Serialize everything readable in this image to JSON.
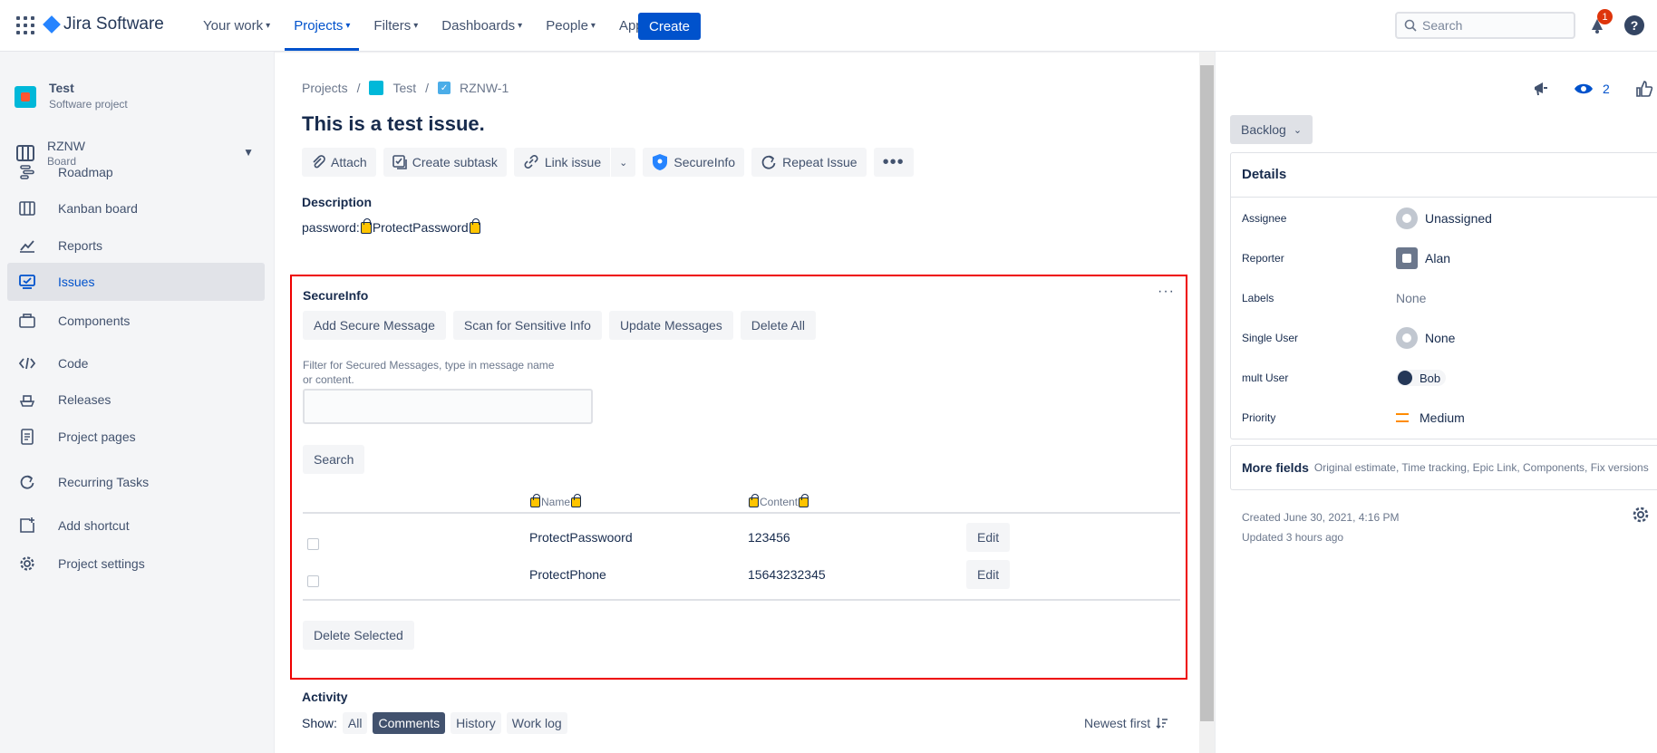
{
  "app": {
    "logo_text": "Jira Software"
  },
  "topnav": {
    "items": [
      {
        "label": "Your work"
      },
      {
        "label": "Projects"
      },
      {
        "label": "Filters"
      },
      {
        "label": "Dashboards"
      },
      {
        "label": "People"
      },
      {
        "label": "Apps"
      }
    ],
    "create_label": "Create",
    "search_placeholder": "Search",
    "notification_count": "1",
    "help_label": "?"
  },
  "sidebar": {
    "project_name": "Test",
    "project_type": "Software project",
    "board_name": "RZNW",
    "board_sub": "Board",
    "items": [
      {
        "label": "Roadmap",
        "icon": "roadmap-icon"
      },
      {
        "label": "Kanban board",
        "icon": "kanban-icon"
      },
      {
        "label": "Reports",
        "icon": "reports-icon"
      },
      {
        "label": "Issues",
        "icon": "issues-icon"
      },
      {
        "label": "Components",
        "icon": "components-icon"
      },
      {
        "label": "Code",
        "icon": "code-icon"
      },
      {
        "label": "Releases",
        "icon": "releases-icon"
      },
      {
        "label": "Project pages",
        "icon": "pages-icon"
      },
      {
        "label": "Recurring Tasks",
        "icon": "recurring-icon"
      },
      {
        "label": "Add shortcut",
        "icon": "add-shortcut-icon"
      },
      {
        "label": "Project settings",
        "icon": "settings-icon"
      }
    ],
    "active_item": "Issues"
  },
  "issue": {
    "breadcrumb": {
      "projects": "Projects",
      "project": "Test",
      "key": "RZNW-1",
      "sep": "/"
    },
    "title": "This is a test issue.",
    "toolbar": {
      "attach": "Attach",
      "create_subtask": "Create subtask",
      "link_issue": "Link issue",
      "secureinfo": "SecureInfo",
      "repeat_issue": "Repeat Issue"
    },
    "description_label": "Description",
    "description_prefix": "password:",
    "description_value": "ProtectPassword"
  },
  "secureinfo": {
    "title": "SecureInfo",
    "actions": {
      "add": "Add Secure Message",
      "scan": "Scan for Sensitive Info",
      "update": "Update Messages",
      "delete_all": "Delete All"
    },
    "filter_label": "Filter for Secured Messages, type in message name or content.",
    "filter_value": "",
    "search_label": "Search",
    "columns": {
      "name": "Name",
      "content": "Content"
    },
    "rows": [
      {
        "name": "ProtectPasswoord",
        "content": "123456",
        "edit": "Edit"
      },
      {
        "name": "ProtectPhone",
        "content": "15643232345",
        "edit": "Edit"
      }
    ],
    "delete_selected": "Delete Selected"
  },
  "activity": {
    "label": "Activity",
    "show_label": "Show:",
    "filters": [
      "All",
      "Comments",
      "History",
      "Work log"
    ],
    "selected_filter": "Comments",
    "sort_label": "Newest first"
  },
  "right_panel": {
    "watchers": "2",
    "status": "Backlog",
    "details_title": "Details",
    "fields": [
      {
        "label": "Assignee",
        "value": "Unassigned"
      },
      {
        "label": "Reporter",
        "value": "Alan"
      },
      {
        "label": "Labels",
        "value": "None"
      },
      {
        "label": "Single User",
        "value": "None"
      },
      {
        "label": "mult User",
        "value": "Bob"
      },
      {
        "label": "Priority",
        "value": "Medium"
      }
    ],
    "more_fields_label": "More fields",
    "more_fields_text": "Original estimate, Time tracking, Epic Link, Components, Fix versions",
    "created": "Created June 30, 2021, 4:16 PM",
    "updated": "Updated 3 hours ago"
  },
  "colors": {
    "accent": "#0052cc",
    "highlight_border": "#ee0000",
    "notification": "#de350b"
  }
}
